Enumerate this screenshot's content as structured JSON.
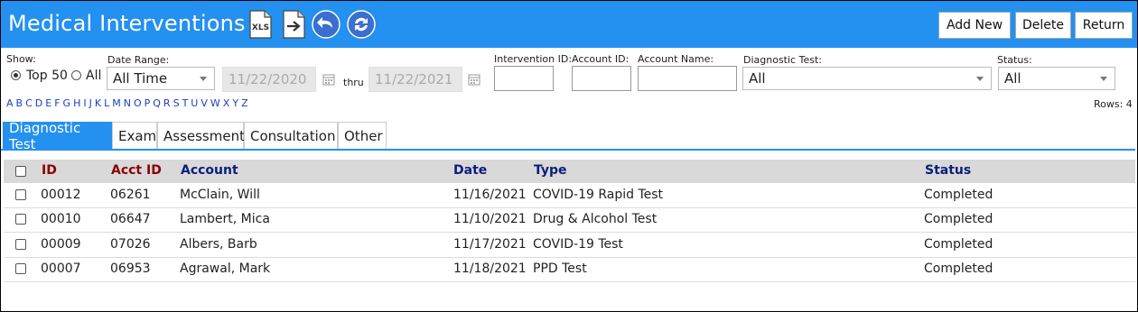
{
  "header": {
    "title": "Medical Interventions",
    "add_new": "Add New",
    "delete": "Delete",
    "return": "Return",
    "xls_label": "XLS"
  },
  "filters": {
    "show_label": "Show:",
    "top50_label": "Top 50",
    "all_label": "All",
    "show_selected": "Top 50",
    "date_range_label": "Date Range:",
    "date_range_value": "All Time",
    "date_from": "11/22/2020",
    "thru_label": "thru",
    "date_to": "11/22/2021",
    "intervention_id_label": "Intervention ID:",
    "account_id_label": "Account ID:",
    "account_name_label": "Account Name:",
    "diagnostic_test_label": "Diagnostic Test:",
    "diagnostic_test_value": "All",
    "status_label": "Status:",
    "status_value": "All",
    "alphabet": [
      "A",
      "B",
      "C",
      "D",
      "E",
      "F",
      "G",
      "H",
      "I",
      "J",
      "K",
      "L",
      "M",
      "N",
      "O",
      "P",
      "Q",
      "R",
      "S",
      "T",
      "U",
      "V",
      "W",
      "X",
      "Y",
      "Z"
    ],
    "rows_count": "Rows: 4"
  },
  "tabs": [
    {
      "label": "Diagnostic Test",
      "active": true
    },
    {
      "label": "Exam",
      "active": false
    },
    {
      "label": "Assessment",
      "active": false
    },
    {
      "label": "Consultation",
      "active": false
    },
    {
      "label": "Other",
      "active": false
    }
  ],
  "table": {
    "columns": {
      "id": "ID",
      "acct_id": "Acct ID",
      "account": "Account",
      "date": "Date",
      "type": "Type",
      "status": "Status"
    },
    "rows": [
      {
        "id": "00012",
        "acct_id": "06261",
        "account": "McClain, Will",
        "date": "11/16/2021",
        "type": "COVID-19 Rapid Test",
        "status": "Completed"
      },
      {
        "id": "00010",
        "acct_id": "06647",
        "account": "Lambert, Mica",
        "date": "11/10/2021",
        "type": "Drug & Alcohol Test",
        "status": "Completed"
      },
      {
        "id": "00009",
        "acct_id": "07026",
        "account": "Albers, Barb",
        "date": "11/17/2021",
        "type": "COVID-19 Test",
        "status": "Completed"
      },
      {
        "id": "00007",
        "acct_id": "06953",
        "account": "Agrawal, Mark",
        "date": "11/18/2021",
        "type": "PPD Test",
        "status": "Completed"
      }
    ]
  },
  "colors": {
    "header_bg": "#2490f0",
    "id_header": "#8b0000",
    "account_header": "#0a1f7a",
    "link": "#1a3fbf"
  },
  "icons": [
    "excel-export-icon",
    "export-arrow-icon",
    "undo-icon",
    "refresh-icon",
    "calendar-icon"
  ]
}
